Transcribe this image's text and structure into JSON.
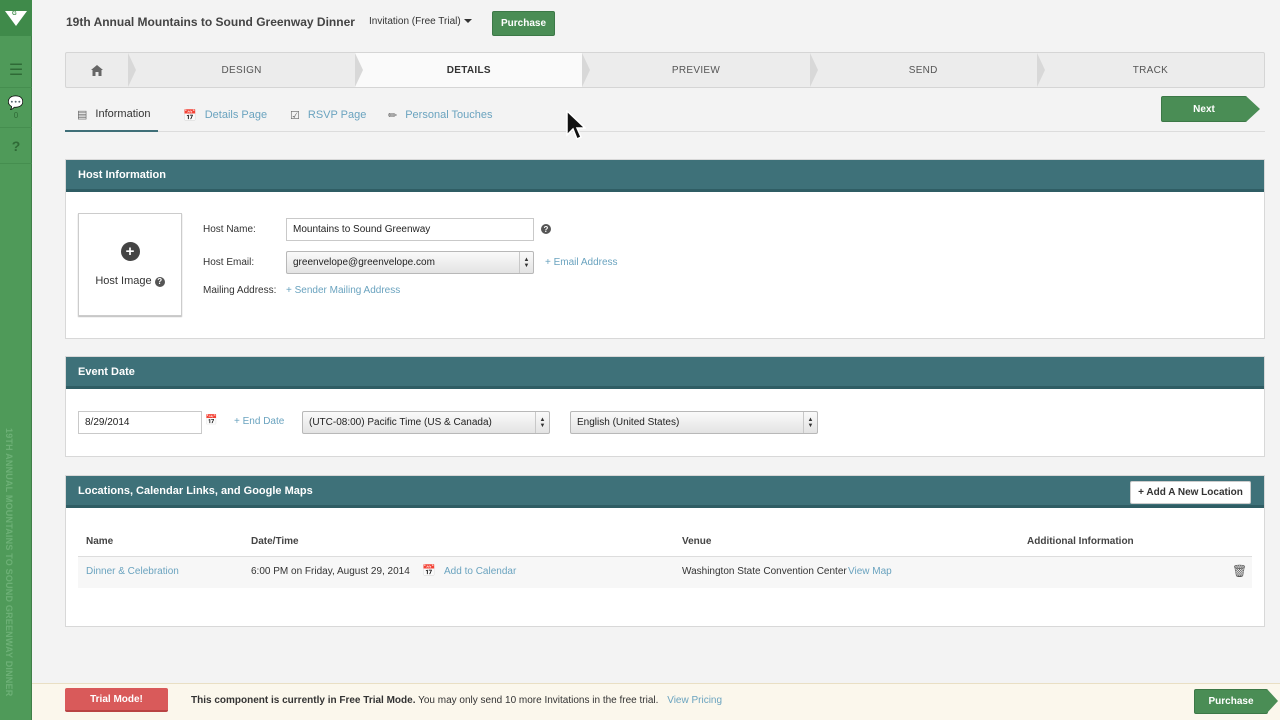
{
  "app": {
    "title": "19th Annual Mountains to Sound Greenway Dinner",
    "sidebar_vertical_title": "19TH ANNUAL MOUNTAINS TO SOUND GREENWAY DINNER",
    "sidebar_comment_count": "0"
  },
  "topbar": {
    "invitation_dropdown": "Invitation (Free Trial)",
    "purchase_label": "Purchase"
  },
  "steps": [
    "DESIGN",
    "DETAILS",
    "PREVIEW",
    "SEND",
    "TRACK"
  ],
  "subtabs": [
    "Information",
    "Details Page",
    "RSVP Page",
    "Personal Touches"
  ],
  "next_label": "Next",
  "host_panel": {
    "title": "Host Information",
    "host_image_label": "Host Image",
    "host_name_label": "Host Name:",
    "host_name_value": "Mountains to Sound Greenway",
    "host_email_label": "Host Email:",
    "host_email_value": "greenvelope@greenvelope.com",
    "add_email_link": "+ Email Address",
    "mailing_label": "Mailing Address:",
    "mailing_link": "+ Sender Mailing Address"
  },
  "event_panel": {
    "title": "Event Date",
    "date_value": "8/29/2014",
    "end_date_link": "+ End Date",
    "timezone_value": "(UTC-08:00) Pacific Time (US & Canada)",
    "language_value": "English (United States)"
  },
  "locations_panel": {
    "title": "Locations, Calendar Links, and Google Maps",
    "add_location_label": "+ Add A New Location",
    "columns": [
      "Name",
      "Date/Time",
      "Venue",
      "Additional Information"
    ],
    "rows": [
      {
        "name": "Dinner & Celebration",
        "datetime": "6:00 PM on Friday, August 29, 2014",
        "add_calendar": "Add to Calendar",
        "venue": "Washington State Convention Center",
        "view_map": "View Map",
        "additional": ""
      }
    ]
  },
  "bottom": {
    "trial_label": "Trial Mode!",
    "message_bold": "This component is currently in Free Trial Mode.",
    "message_rest": " You may only send 10 more Invitations in the free trial.",
    "view_pricing": "View Pricing",
    "purchase_label": "Purchase"
  },
  "colors": {
    "brand_green": "#4a8d55",
    "panel_header": "#3e7179",
    "link_blue": "#6aa3bf",
    "trial_red": "#d95a5a"
  }
}
